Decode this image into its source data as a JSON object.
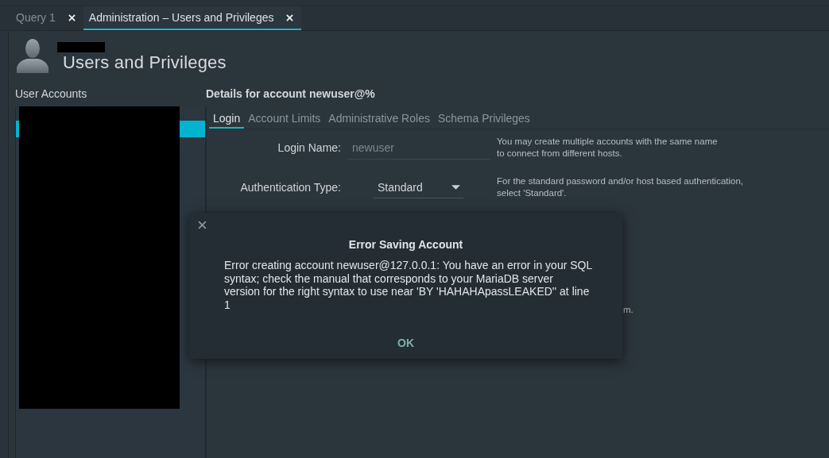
{
  "tabs": [
    {
      "label": "Query 1",
      "selected": false
    },
    {
      "label": "Administration – Users and Privileges",
      "selected": true
    }
  ],
  "header": {
    "title": "Users and Privileges"
  },
  "accounts": {
    "heading": "User Accounts",
    "rows": [
      {
        "selected": true
      }
    ]
  },
  "details": {
    "heading": "Details for account newuser@%",
    "tabs": [
      {
        "label": "Login",
        "selected": true
      },
      {
        "label": "Account Limits",
        "selected": false
      },
      {
        "label": "Administrative Roles",
        "selected": false
      },
      {
        "label": "Schema Privileges",
        "selected": false
      }
    ],
    "sections": [
      {
        "fields": [
          {
            "kind": "text",
            "label": "Login Name:",
            "value": "newuser",
            "help": "You may create multiple accounts with the same name\nto connect from different hosts."
          },
          {
            "kind": "select",
            "label": "Authentication Type:",
            "value": "Standard",
            "help": "For the standard password and/or host based authentication,\nselect 'Standard'."
          }
        ]
      },
      {
        "fields": [
          {
            "kind": "covered",
            "help": "m."
          }
        ]
      }
    ]
  },
  "dialog": {
    "title": "Error Saving Account",
    "message": "Error creating account newuser@127.0.0.1: You have an error in your SQL\nsyntax; check the manual that corresponds to your MariaDB server\nversion for the right syntax to use near 'BY 'HAHAHApassLEAKED'' at line\n1",
    "buttons": [
      "OK"
    ]
  }
}
